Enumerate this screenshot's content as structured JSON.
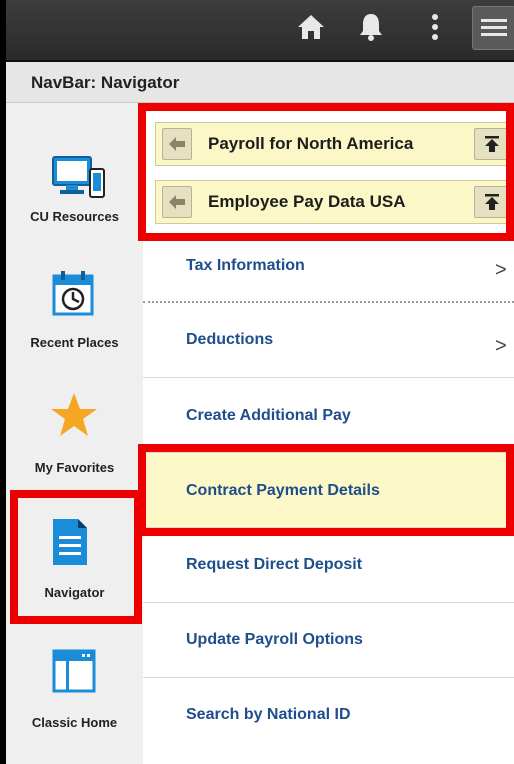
{
  "topbar": {
    "icons": [
      "home-icon",
      "bell-icon",
      "more-options-icon",
      "navbar-menu-icon"
    ]
  },
  "navbar": {
    "title": "NavBar: Navigator"
  },
  "tiles": [
    {
      "label": "CU Resources",
      "icon": "devices-icon"
    },
    {
      "label": "Recent Places",
      "icon": "calendar-clock-icon"
    },
    {
      "label": "My Favorites",
      "icon": "star-icon"
    },
    {
      "label": "Navigator",
      "icon": "document-icon"
    },
    {
      "label": "Classic Home",
      "icon": "window-icon"
    }
  ],
  "breadcrumbs": [
    {
      "label": "Payroll for North America"
    },
    {
      "label": "Employee Pay Data USA"
    }
  ],
  "nav_items": [
    {
      "label": "Tax Information",
      "chevron": ">"
    },
    {
      "label": "Deductions",
      "chevron": ">"
    },
    {
      "label": "Create Additional Pay"
    },
    {
      "label": "Contract Payment Details"
    },
    {
      "label": "Request Direct Deposit"
    },
    {
      "label": "Update Payroll Options"
    },
    {
      "label": "Search by National ID"
    }
  ],
  "colors": {
    "highlight_red": "#ee0000",
    "crumb_yellow": "#fbf7c6",
    "link_blue": "#1f4e8c",
    "tile_accent_blue": "#1a8cd8",
    "star_orange": "#f5a623"
  }
}
